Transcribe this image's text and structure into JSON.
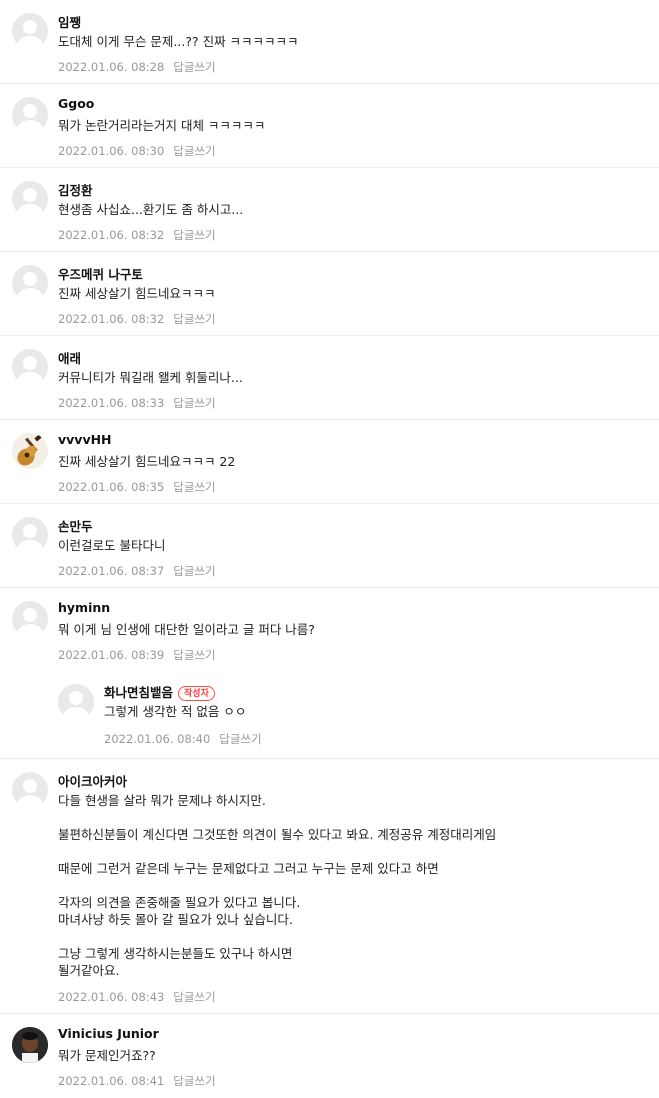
{
  "reply_link_label": "답글쓰기",
  "author_badge": "작성자",
  "comments": [
    {
      "nick": "임쨍",
      "text": "도대체 이게 무슨 문제...?? 진짜 ㅋㅋㅋㅋㅋㅋ",
      "date": "2022.01.06. 08:28"
    },
    {
      "nick": "Ggoo",
      "text": "뭐가 논란거리라는거지 대체 ㅋㅋㅋㅋㅋ",
      "date": "2022.01.06. 08:30"
    },
    {
      "nick": "김정환",
      "text": "현생좀 사십쇼...환기도 좀 하시고...",
      "date": "2022.01.06. 08:32"
    },
    {
      "nick": "우즈메퀴 나구토",
      "text": "진짜 세상살기 힘드네요ㅋㅋㅋ",
      "date": "2022.01.06. 08:32"
    },
    {
      "nick": "애래",
      "text": "커뮤니티가 뭐길래 왤케 휘둘리나...",
      "date": "2022.01.06. 08:33"
    },
    {
      "nick": "vvvvHH",
      "text": "진짜 세상살기 힘드네요ㅋㅋㅋ 22",
      "date": "2022.01.06. 08:35",
      "avatar": "guitar-icon"
    },
    {
      "nick": "손만두",
      "text": "이런걸로도 불타다니",
      "date": "2022.01.06. 08:37"
    },
    {
      "nick": "hyminn",
      "text": "뭐 이게 님 인생에 대단한 일이라고 글 퍼다 나름?",
      "date": "2022.01.06. 08:39"
    },
    {
      "nick": "화나면침뱉음",
      "text": "그렇게 생각한 적 없음 ㅇㅇ",
      "date": "2022.01.06. 08:40",
      "reply": true,
      "author": true
    },
    {
      "nick": "아이크아커아",
      "text": "다들 현생을 살라 뭐가 문제냐 하시지만.\n\n불편하신분들이 계신다면 그것또한 의견이 될수 있다고 봐요. 계정공유 계정대리게임\n\n때문에 그런거 같은데 누구는 문제없다고 그러고 누구는 문제 있다고 하면\n\n각자의 의견을 존중해줄 필요가 있다고 봅니다.\n마녀사냥 하듯 몰아 갈 필요가 있나 싶습니다.\n\n그냥 그렇게 생각하시는분들도 있구나 하시면\n될거같아요.",
      "date": "2022.01.06. 08:43"
    },
    {
      "nick": "Vinicius Junior",
      "text": "뭐가 문제인거죠??",
      "date": "2022.01.06. 08:41",
      "avatar": "player-photo-icon"
    }
  ]
}
